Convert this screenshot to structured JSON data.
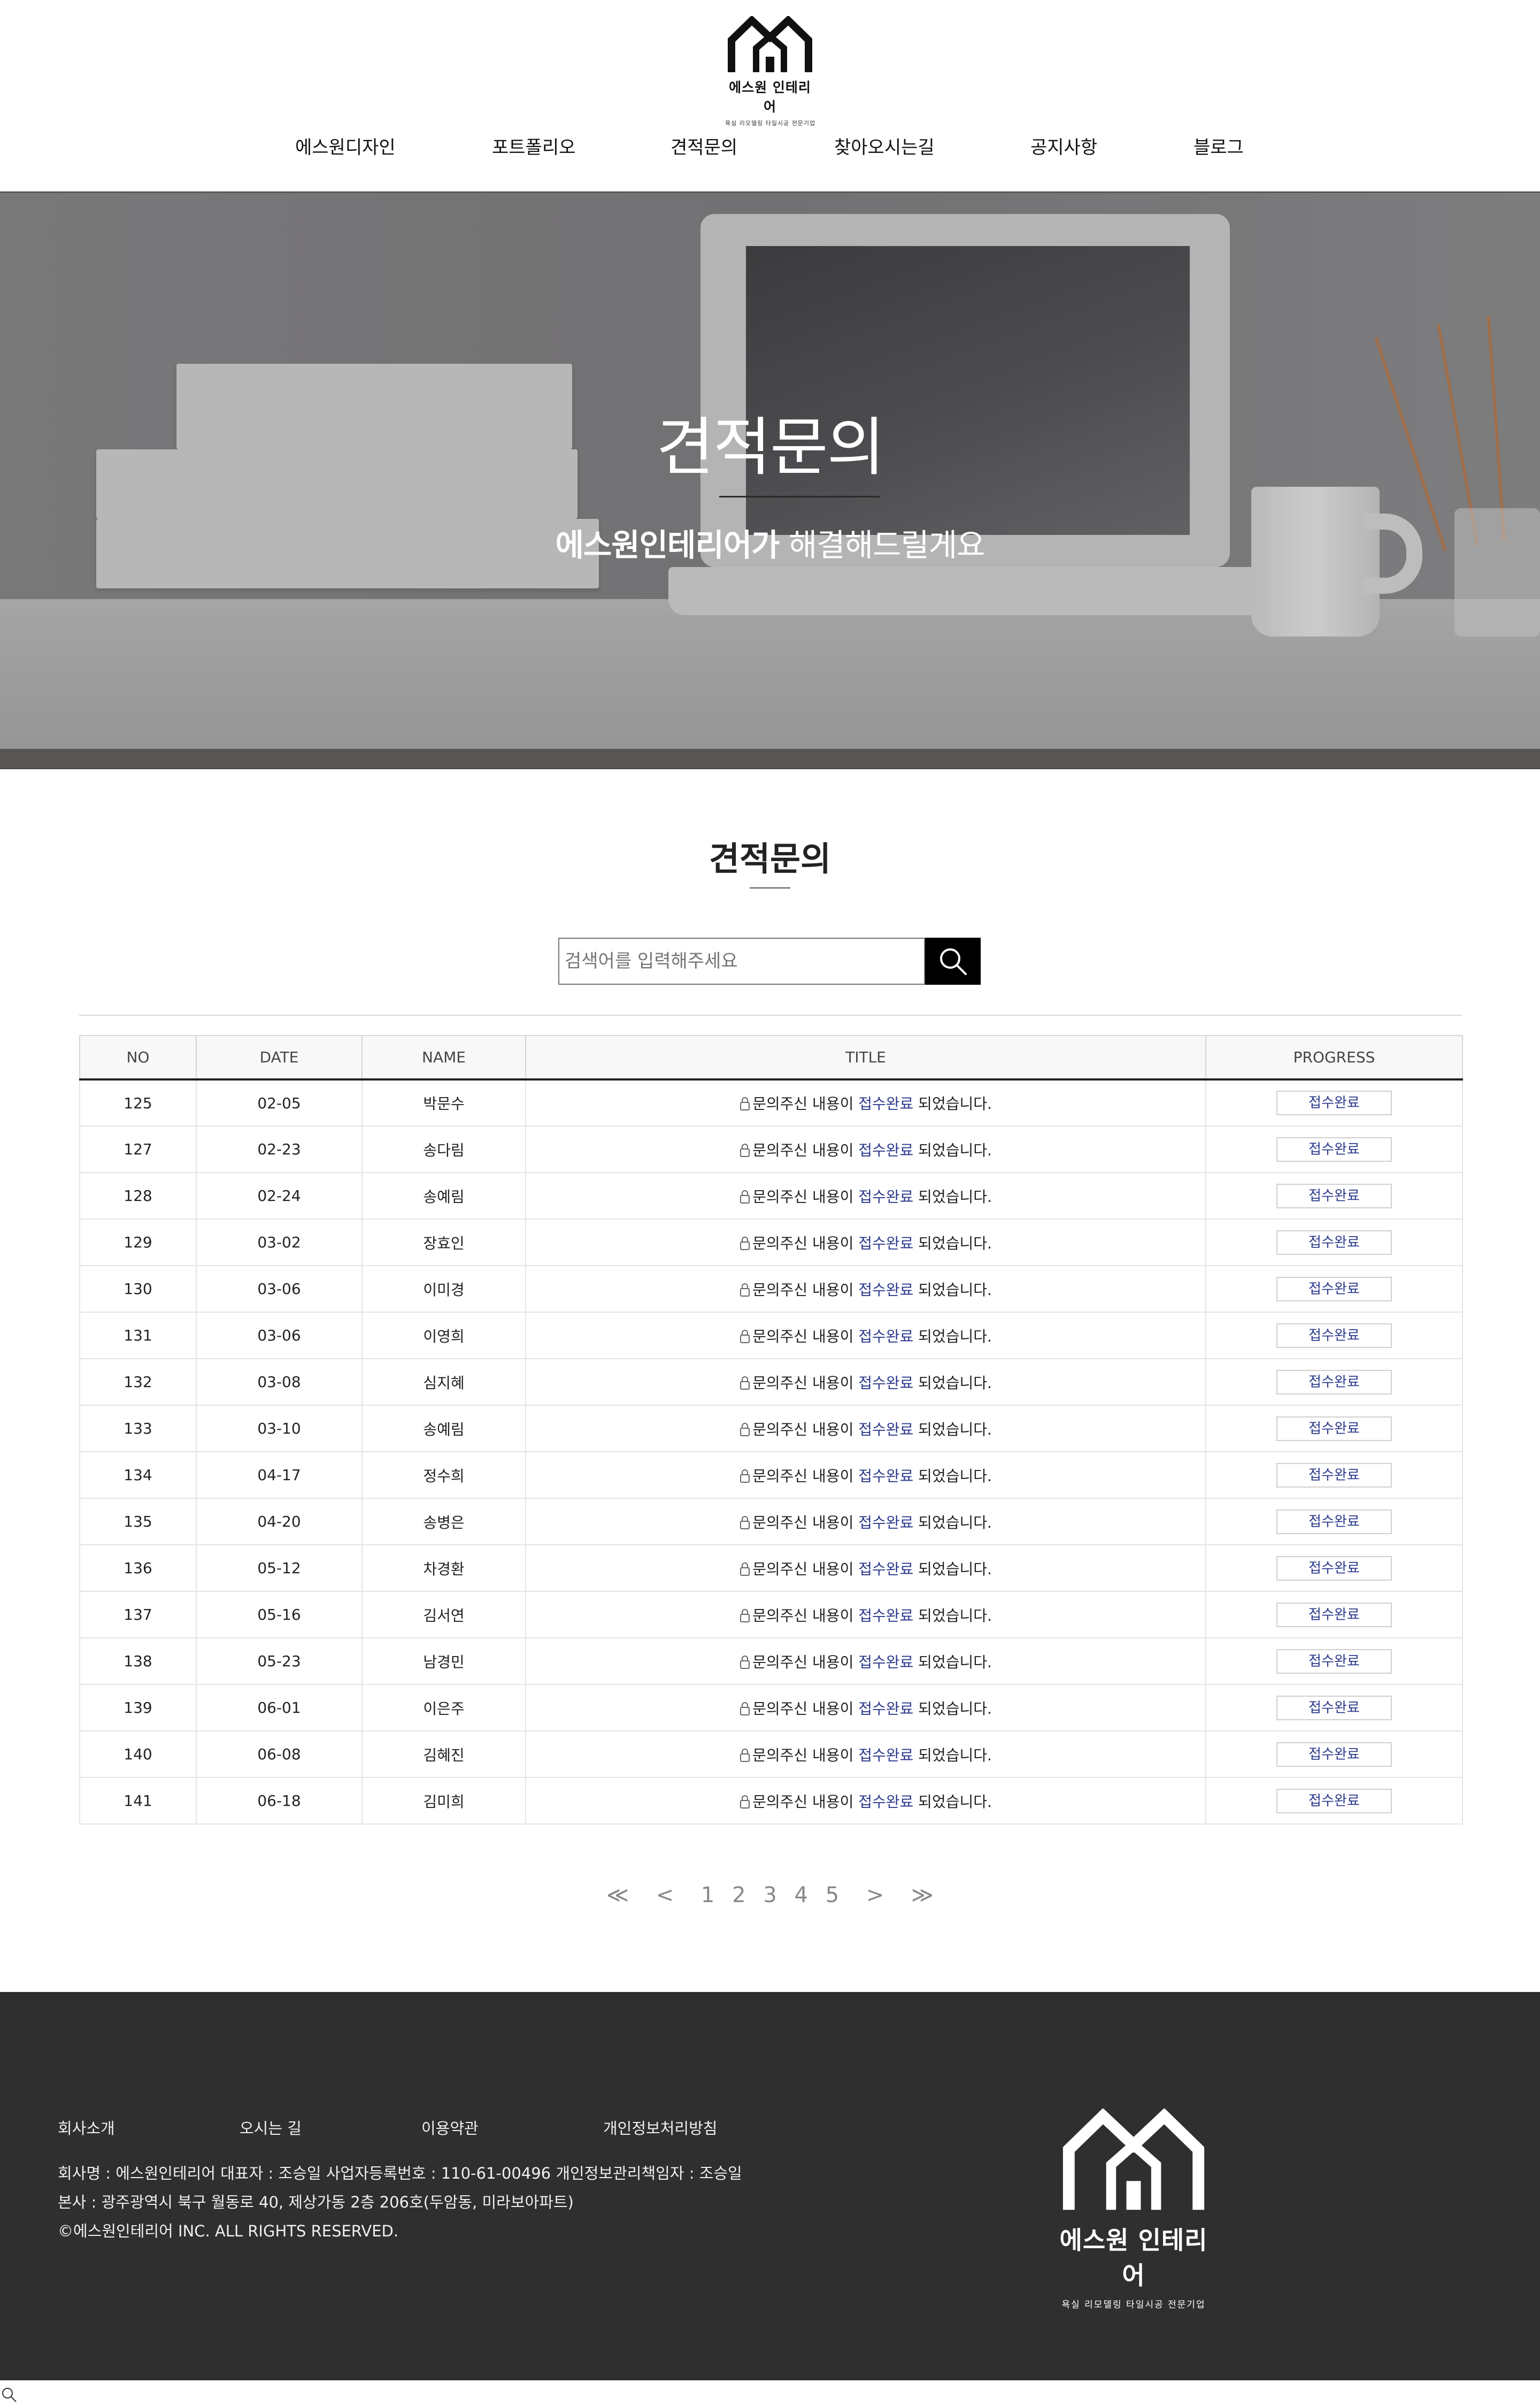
{
  "brand": {
    "name": "에스원 인테리어",
    "tagline": "욕실 리모델링 타일시공 전문기업"
  },
  "nav": {
    "items": [
      "에스원디자인",
      "포트폴리오",
      "견적문의",
      "찾아오시는길",
      "공지사항",
      "블로그"
    ]
  },
  "hero": {
    "title": "견적문의",
    "subtitle_bold": "에스원인테리어가",
    "subtitle_rest": " 해결해드릴게요"
  },
  "section": {
    "title": "견적문의"
  },
  "search": {
    "placeholder": "검색어를 입력해주세요"
  },
  "table": {
    "headers": [
      "NO",
      "DATE",
      "NAME",
      "TITLE",
      "PROGRESS"
    ],
    "title_prefix": "문의주신 내용이 ",
    "title_highlight": "접수완료",
    "title_suffix": " 되었습니다.",
    "rows": [
      {
        "no": "125",
        "date": "02-05",
        "name": "박문수",
        "progress": "접수완료"
      },
      {
        "no": "127",
        "date": "02-23",
        "name": "송다림",
        "progress": "접수완료"
      },
      {
        "no": "128",
        "date": "02-24",
        "name": "송예림",
        "progress": "접수완료"
      },
      {
        "no": "129",
        "date": "03-02",
        "name": "장효인",
        "progress": "접수완료"
      },
      {
        "no": "130",
        "date": "03-06",
        "name": "이미경",
        "progress": "접수완료"
      },
      {
        "no": "131",
        "date": "03-06",
        "name": "이영희",
        "progress": "접수완료"
      },
      {
        "no": "132",
        "date": "03-08",
        "name": "심지혜",
        "progress": "접수완료"
      },
      {
        "no": "133",
        "date": "03-10",
        "name": "송예림",
        "progress": "접수완료"
      },
      {
        "no": "134",
        "date": "04-17",
        "name": "정수희",
        "progress": "접수완료"
      },
      {
        "no": "135",
        "date": "04-20",
        "name": "송병은",
        "progress": "접수완료"
      },
      {
        "no": "136",
        "date": "05-12",
        "name": "차경환",
        "progress": "접수완료"
      },
      {
        "no": "137",
        "date": "05-16",
        "name": "김서연",
        "progress": "접수완료"
      },
      {
        "no": "138",
        "date": "05-23",
        "name": "남경민",
        "progress": "접수완료"
      },
      {
        "no": "139",
        "date": "06-01",
        "name": "이은주",
        "progress": "접수완료"
      },
      {
        "no": "140",
        "date": "06-08",
        "name": "김혜진",
        "progress": "접수완료"
      },
      {
        "no": "141",
        "date": "06-18",
        "name": "김미희",
        "progress": "접수완료"
      }
    ]
  },
  "pagination": {
    "first": "≪",
    "prev": "<",
    "pages": [
      "1",
      "2",
      "3",
      "4",
      "5"
    ],
    "next": ">",
    "last": "≫"
  },
  "footer": {
    "links": [
      "회사소개",
      "오시는 길",
      "이용약관",
      "개인정보처리방침"
    ],
    "info_line1": "회사명 : 에스원인테리어 대표자 : 조승일 사업자등록번호 : 110-61-00496 개인정보관리책임자 : 조승일",
    "info_line2": "본사 : 광주광역시 북구 월동로 40, 제상가동 2층 206호(두암동, 미라보아파트)",
    "copyright": "©에스원인테리어 INC. ALL RIGHTS RESERVED.",
    "logo_name": "에스원 인테리어",
    "logo_sub": "욕실 리모델링 타일시공 전문기업"
  },
  "colors": {
    "accent": "#2c3a8c",
    "footer_bg": "#2f2f2f",
    "search_button": "#000000"
  },
  "icons": {
    "search": "search-icon",
    "lock": "lock-icon",
    "logo": "house-logo-icon"
  }
}
